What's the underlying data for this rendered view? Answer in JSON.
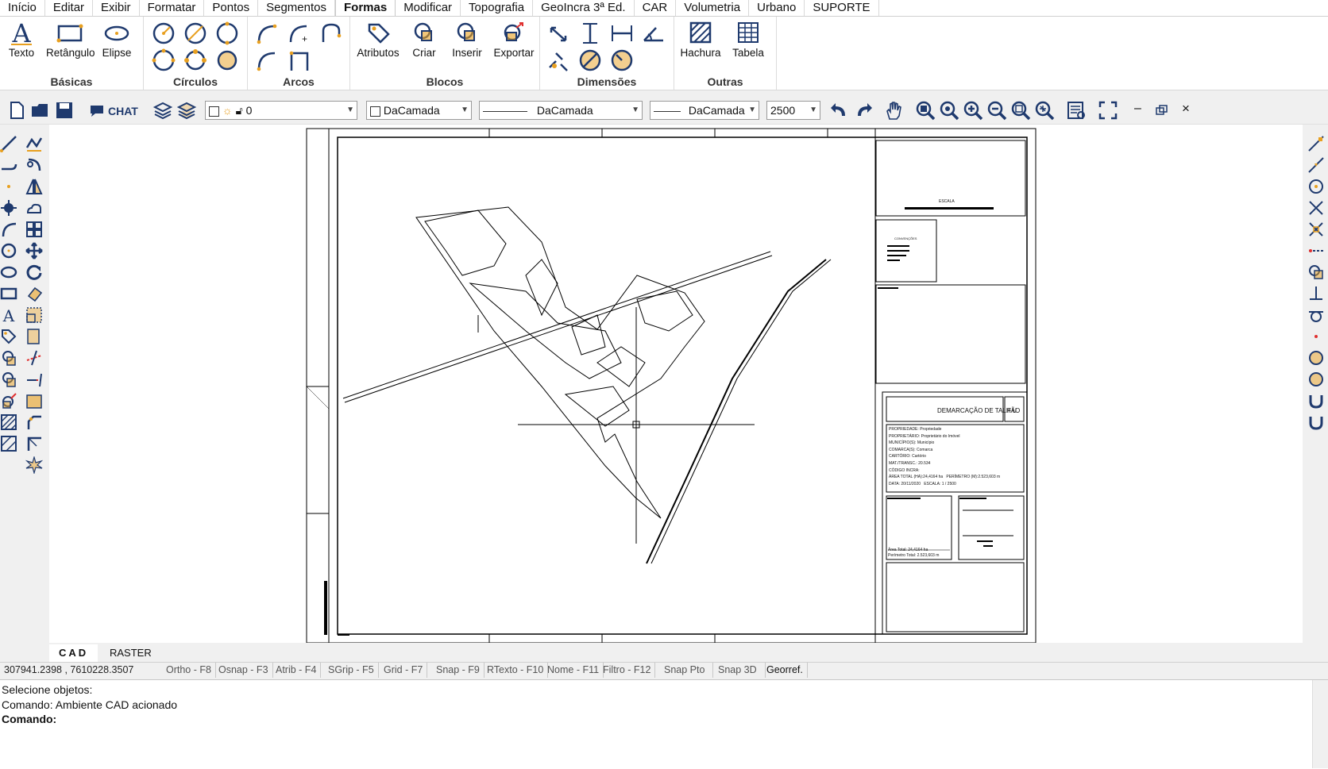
{
  "menu": {
    "items": [
      "Início",
      "Editar",
      "Exibir",
      "Formatar",
      "Pontos",
      "Segmentos",
      "Formas",
      "Modificar",
      "Topografia",
      "GeoIncra 3ª Ed.",
      "CAR",
      "Volumetria",
      "Urbano",
      "SUPORTE"
    ],
    "active": "Formas"
  },
  "ribbon": {
    "basicas": {
      "title": "Básicas",
      "texto": "Texto",
      "retangulo": "Retângulo",
      "elipse": "Elipse"
    },
    "circulos": {
      "title": "Círculos"
    },
    "arcos": {
      "title": "Arcos"
    },
    "blocos": {
      "title": "Blocos",
      "atributos": "Atributos",
      "criar": "Criar",
      "inserir": "Inserir",
      "exportar": "Exportar"
    },
    "dimensoes": {
      "title": "Dimensões"
    },
    "outras": {
      "title": "Outras",
      "hachura": "Hachura",
      "tabela": "Tabela"
    }
  },
  "toolbar": {
    "chat": "CHAT",
    "layer": "0",
    "color": "DaCamada",
    "linetype": "DaCamada",
    "lineweight": "DaCamada",
    "scale": "2500",
    "win_min": "–",
    "win_close": "×"
  },
  "drawing": {
    "title": "DEMARCAÇÃO DE TALHÃO",
    "fu": "F.U.",
    "escala": "ESCALA",
    "convencoes": "CONVENÇÕES",
    "fields": [
      {
        "k": "PROPRIEDADE:",
        "v": "Propriedade"
      },
      {
        "k": "PROPRIETÁRIO:",
        "v": "Proprietário do Imóvel"
      },
      {
        "k": "MUNICÍPIO(S):",
        "v": "Município"
      },
      {
        "k": "COMARCA(S):",
        "v": "Comarca"
      },
      {
        "k": "CARTÓRIO:",
        "v": "Cartório"
      },
      {
        "k": "MAT./TRANSC.:",
        "v": "20.534"
      },
      {
        "k": "CÓDIGO INCRA:",
        "v": ""
      }
    ],
    "area_total": "ÁREA TOTAL (HA):24,4164 ha",
    "perimetro": "PERÍMETRO (M):2.523,603 m",
    "data": "DATA:",
    "data_val": "20/11/2020",
    "escala_val": "ESCALA: 1 / 2500",
    "area_label": "Área Total:",
    "area_val": "24,4164 ha",
    "perim_label": "Perímetro Total:",
    "perim_val": "2.523,603 m"
  },
  "tabs": {
    "cad": "CAD",
    "raster": "RASTER"
  },
  "status": {
    "coords": "307941.2398 , 7610228.3507",
    "toggles": [
      "Ortho - F8",
      "Osnap - F3",
      "Atrib - F4",
      "SGrip - F5",
      "Grid - F7",
      "Snap - F9",
      "RTexto - F10",
      "Nome - F11",
      "Filtro - F12",
      "Snap Pto",
      "Snap 3D",
      "Georref."
    ]
  },
  "command": {
    "lines": [
      "Selecione objetos:",
      "Comando: Ambiente CAD acionado",
      "Comando:"
    ]
  },
  "colors": {
    "accent": "#e8a020",
    "icon_blue": "#1f3a6e"
  }
}
